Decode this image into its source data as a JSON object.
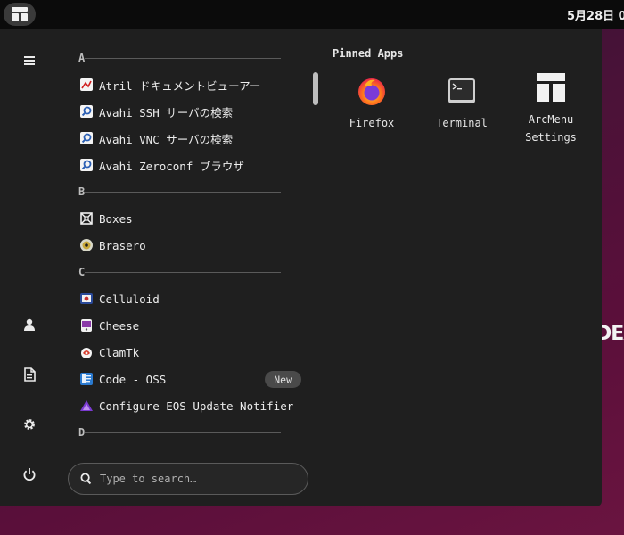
{
  "topbar": {
    "clock": "5月28日 0"
  },
  "wallpaper": {
    "text": "EDEA"
  },
  "sidebar": {
    "items": [
      {
        "name": "menu-icon"
      },
      {
        "name": "user-icon"
      },
      {
        "name": "document-icon"
      },
      {
        "name": "gear-icon"
      },
      {
        "name": "power-icon"
      }
    ]
  },
  "apps": {
    "sections": [
      {
        "letter": "A",
        "items": [
          {
            "label": "Atril ドキュメントビューアー",
            "icon": "atril-icon"
          },
          {
            "label": "Avahi SSH サーバの検索",
            "icon": "avahi-ssh-icon"
          },
          {
            "label": "Avahi VNC サーバの検索",
            "icon": "avahi-vnc-icon"
          },
          {
            "label": "Avahi Zeroconf ブラウザ",
            "icon": "avahi-zeroconf-icon"
          }
        ]
      },
      {
        "letter": "B",
        "items": [
          {
            "label": "Boxes",
            "icon": "boxes-icon"
          },
          {
            "label": "Brasero",
            "icon": "brasero-icon"
          }
        ]
      },
      {
        "letter": "C",
        "items": [
          {
            "label": "Celluloid",
            "icon": "celluloid-icon"
          },
          {
            "label": "Cheese",
            "icon": "cheese-icon"
          },
          {
            "label": "ClamTk",
            "icon": "clamtk-icon"
          },
          {
            "label": "Code - OSS",
            "icon": "code-oss-icon",
            "badge": "New"
          },
          {
            "label": "Configure EOS Update Notifier",
            "icon": "eos-notifier-icon"
          }
        ]
      },
      {
        "letter": "D",
        "items": []
      }
    ]
  },
  "search": {
    "placeholder": "Type to search…"
  },
  "pinned": {
    "title": "Pinned Apps",
    "apps": [
      {
        "label": "Firefox",
        "icon": "firefox-icon"
      },
      {
        "label": "Terminal",
        "icon": "terminal-icon"
      },
      {
        "label": "ArcMenu Settings",
        "label_lines": [
          "ArcMenu",
          "Settings"
        ],
        "icon": "arcmenu-settings-icon"
      }
    ]
  }
}
